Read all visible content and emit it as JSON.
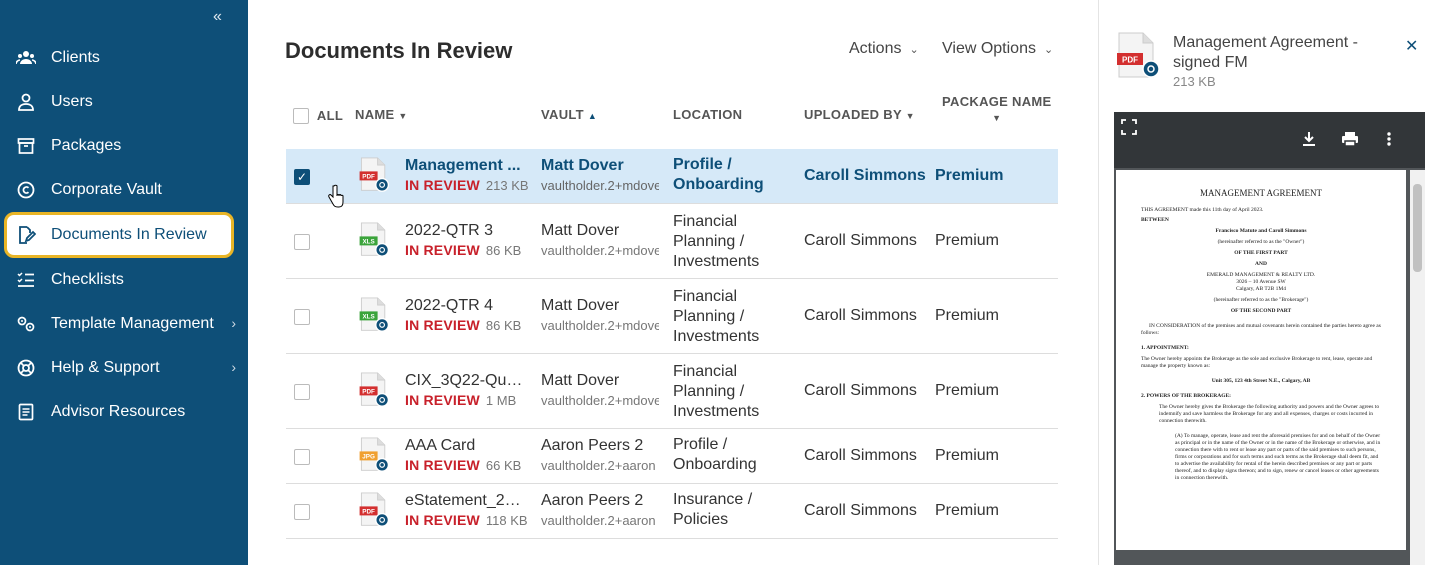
{
  "sidebar": {
    "collapse_glyph": "«",
    "items": [
      {
        "label": "Clients",
        "icon": "clients-icon"
      },
      {
        "label": "Users",
        "icon": "user-icon"
      },
      {
        "label": "Packages",
        "icon": "package-icon"
      },
      {
        "label": "Corporate Vault",
        "icon": "copyright-icon"
      },
      {
        "label": "Documents In Review",
        "icon": "document-edit-icon",
        "active": true
      },
      {
        "label": "Checklists",
        "icon": "checklist-icon"
      },
      {
        "label": "Template Management",
        "icon": "template-gear-icon",
        "has_submenu": true
      },
      {
        "label": "Help & Support",
        "icon": "lifebuoy-icon",
        "has_submenu": true
      },
      {
        "label": "Advisor Resources",
        "icon": "resources-icon"
      }
    ],
    "chevron_glyph": "›"
  },
  "main": {
    "title": "Documents In Review",
    "actions_label": "Actions",
    "view_options_label": "View Options",
    "columns": {
      "all": "ALL",
      "name": "NAME",
      "vault": "VAULT",
      "location": "LOCATION",
      "uploaded_by": "UPLOADED BY",
      "package_name": "PACKAGE NAME"
    },
    "rows": [
      {
        "name": "Management ...",
        "type": "PDF",
        "status": "IN REVIEW",
        "size": "213 KB",
        "vault_name": "Matt Dover",
        "vault_email": "vaultholder.2+mdover",
        "location": "Profile / Onboarding",
        "uploaded_by": "Caroll Simmons",
        "package": "Premium",
        "checked": true
      },
      {
        "name": "2022-QTR 3",
        "type": "XLS",
        "status": "IN REVIEW",
        "size": "86 KB",
        "vault_name": "Matt Dover",
        "vault_email": "vaultholder.2+mdover",
        "location": "Financial Planning / Investments",
        "uploaded_by": "Caroll Simmons",
        "package": "Premium",
        "checked": false
      },
      {
        "name": "2022-QTR 4",
        "type": "XLS",
        "status": "IN REVIEW",
        "size": "86 KB",
        "vault_name": "Matt Dover",
        "vault_email": "vaultholder.2+mdover",
        "location": "Financial Planning / Investments",
        "uploaded_by": "Caroll Simmons",
        "package": "Premium",
        "checked": false
      },
      {
        "name": "CIX_3Q22-Quar...",
        "type": "PDF",
        "status": "IN REVIEW",
        "size": "1 MB",
        "vault_name": "Matt Dover",
        "vault_email": "vaultholder.2+mdover",
        "location": "Financial Planning / Investments",
        "uploaded_by": "Caroll Simmons",
        "package": "Premium",
        "checked": false
      },
      {
        "name": "AAA Card",
        "type": "JPG",
        "status": "IN REVIEW",
        "size": "66 KB",
        "vault_name": "Aaron Peers 2",
        "vault_email": "vaultholder.2+aaron",
        "location": "Profile / Onboarding",
        "uploaded_by": "Caroll Simmons",
        "package": "Premium",
        "checked": false
      },
      {
        "name": "eStatement_20...",
        "type": "PDF",
        "status": "IN REVIEW",
        "size": "118 KB",
        "vault_name": "Aaron Peers 2",
        "vault_email": "vaultholder.2+aaron",
        "location": "Insurance / Policies",
        "uploaded_by": "Caroll Simmons",
        "package": "Premium",
        "checked": false
      }
    ]
  },
  "preview": {
    "title": "Management Agreement - signed FM",
    "size": "213 KB",
    "file_type": "PDF",
    "doc": {
      "heading": "MANAGEMENT AGREEMENT",
      "intro": "THIS AGREEMENT made this 11th day of April 2023.",
      "between": "BETWEEN",
      "party1": "Francisco Matute and Caroll Simmons",
      "party1_ref": "(hereinafter referred to as the \"Owner\")",
      "first_part": "OF THE FIRST PART",
      "and": "AND",
      "party2": "EMERALD MANAGEMENT & REALTY LTD.",
      "party2_addr1": "3026 – 10 Avenue SW",
      "party2_addr2": "Calgary, AB  T2B 1M4",
      "party2_ref": "(hereinafter referred to as the \"Brokerage\")",
      "second_part": "OF THE SECOND PART",
      "consideration": "IN CONSIDERATION of the premises and mutual covenants herein contained the parties hereto agree as follows:",
      "s1_title": "1.      APPOINTMENT:",
      "s1_text": "The Owner hereby appoints the Brokerage as the sole and exclusive Brokerage to rent, lease, operate and manage the property known as:",
      "property": "Unit 305, 123 4th Street N.E., Calgary, AB",
      "s2_title": "2.      POWERS OF THE BROKERAGE:",
      "s2_text": "The Owner hereby gives the Brokerage the following authority and powers and the Owner agrees to indemnify and save harmless the Brokerage for any and all expenses, charges or costs incurred in connection therewith.",
      "s2a_text": "(A)   To manage, operate, lease and rent the aforesaid premises for and on behalf of the Owner as principal or in the name of the Owner or in the name of the Brokerage or otherwise, and in connection there with to rent or lease any part or parts of the said premises to such persons, firms or corporations and for such terms and such terms as the Brokerage shall deem fit, and to advertise the availability for rental of the herein described premises or any part or parts thereof, and to display signs thereon; and to sign, renew or cancel leases or other agreements in connection therewith."
    }
  },
  "colors": {
    "sidebar_bg": "#0e4f78",
    "active_outline": "#e9b526",
    "status_red": "#c8202a",
    "selected_row": "#d6e9f8"
  }
}
